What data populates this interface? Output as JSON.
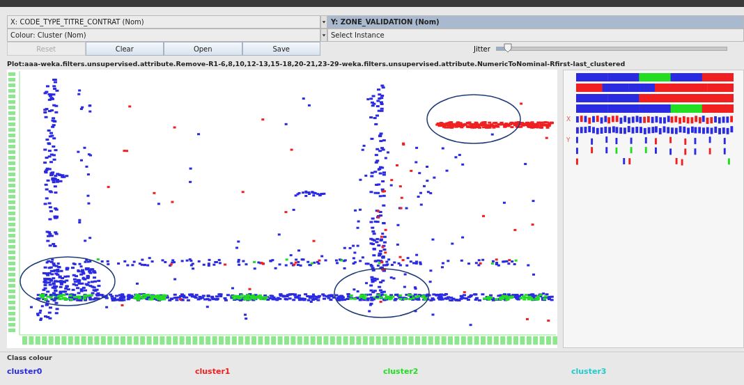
{
  "x_axis_select": {
    "value": "X: CODE_TYPE_TITRE_CONTRAT (Nom)"
  },
  "y_axis_select": {
    "value": "Y: ZONE_VALIDATION (Nom)"
  },
  "colour_select": {
    "value": "Colour: Cluster (Nom)"
  },
  "instance_select": {
    "value": "Select Instance"
  },
  "buttons": [
    {
      "label": "Reset",
      "disabled": true
    },
    {
      "label": "Clear",
      "disabled": false
    },
    {
      "label": "Open",
      "disabled": false
    },
    {
      "label": "Save",
      "disabled": false
    }
  ],
  "jitter": {
    "label": "Jitter",
    "level": 0.05
  },
  "plot_title": "Plot:aaa-weka.filters.unsupervised.attribute.Remove-R1-6,8,10,12-13,15-18,20-21,23-29-weka.filters.unsupervised.attribute.NumericToNominal-Rfirst-last_clustered",
  "attribute_panel": {
    "x_marker": "X",
    "y_marker": "Y"
  },
  "class_colour": {
    "title": "Class colour",
    "classes": [
      {
        "label": "cluster0",
        "color": "#2a2ae0"
      },
      {
        "label": "cluster1",
        "color": "#f02020"
      },
      {
        "label": "cluster2",
        "color": "#22dd22"
      },
      {
        "label": "cluster3",
        "color": "#22cccc"
      }
    ]
  }
}
